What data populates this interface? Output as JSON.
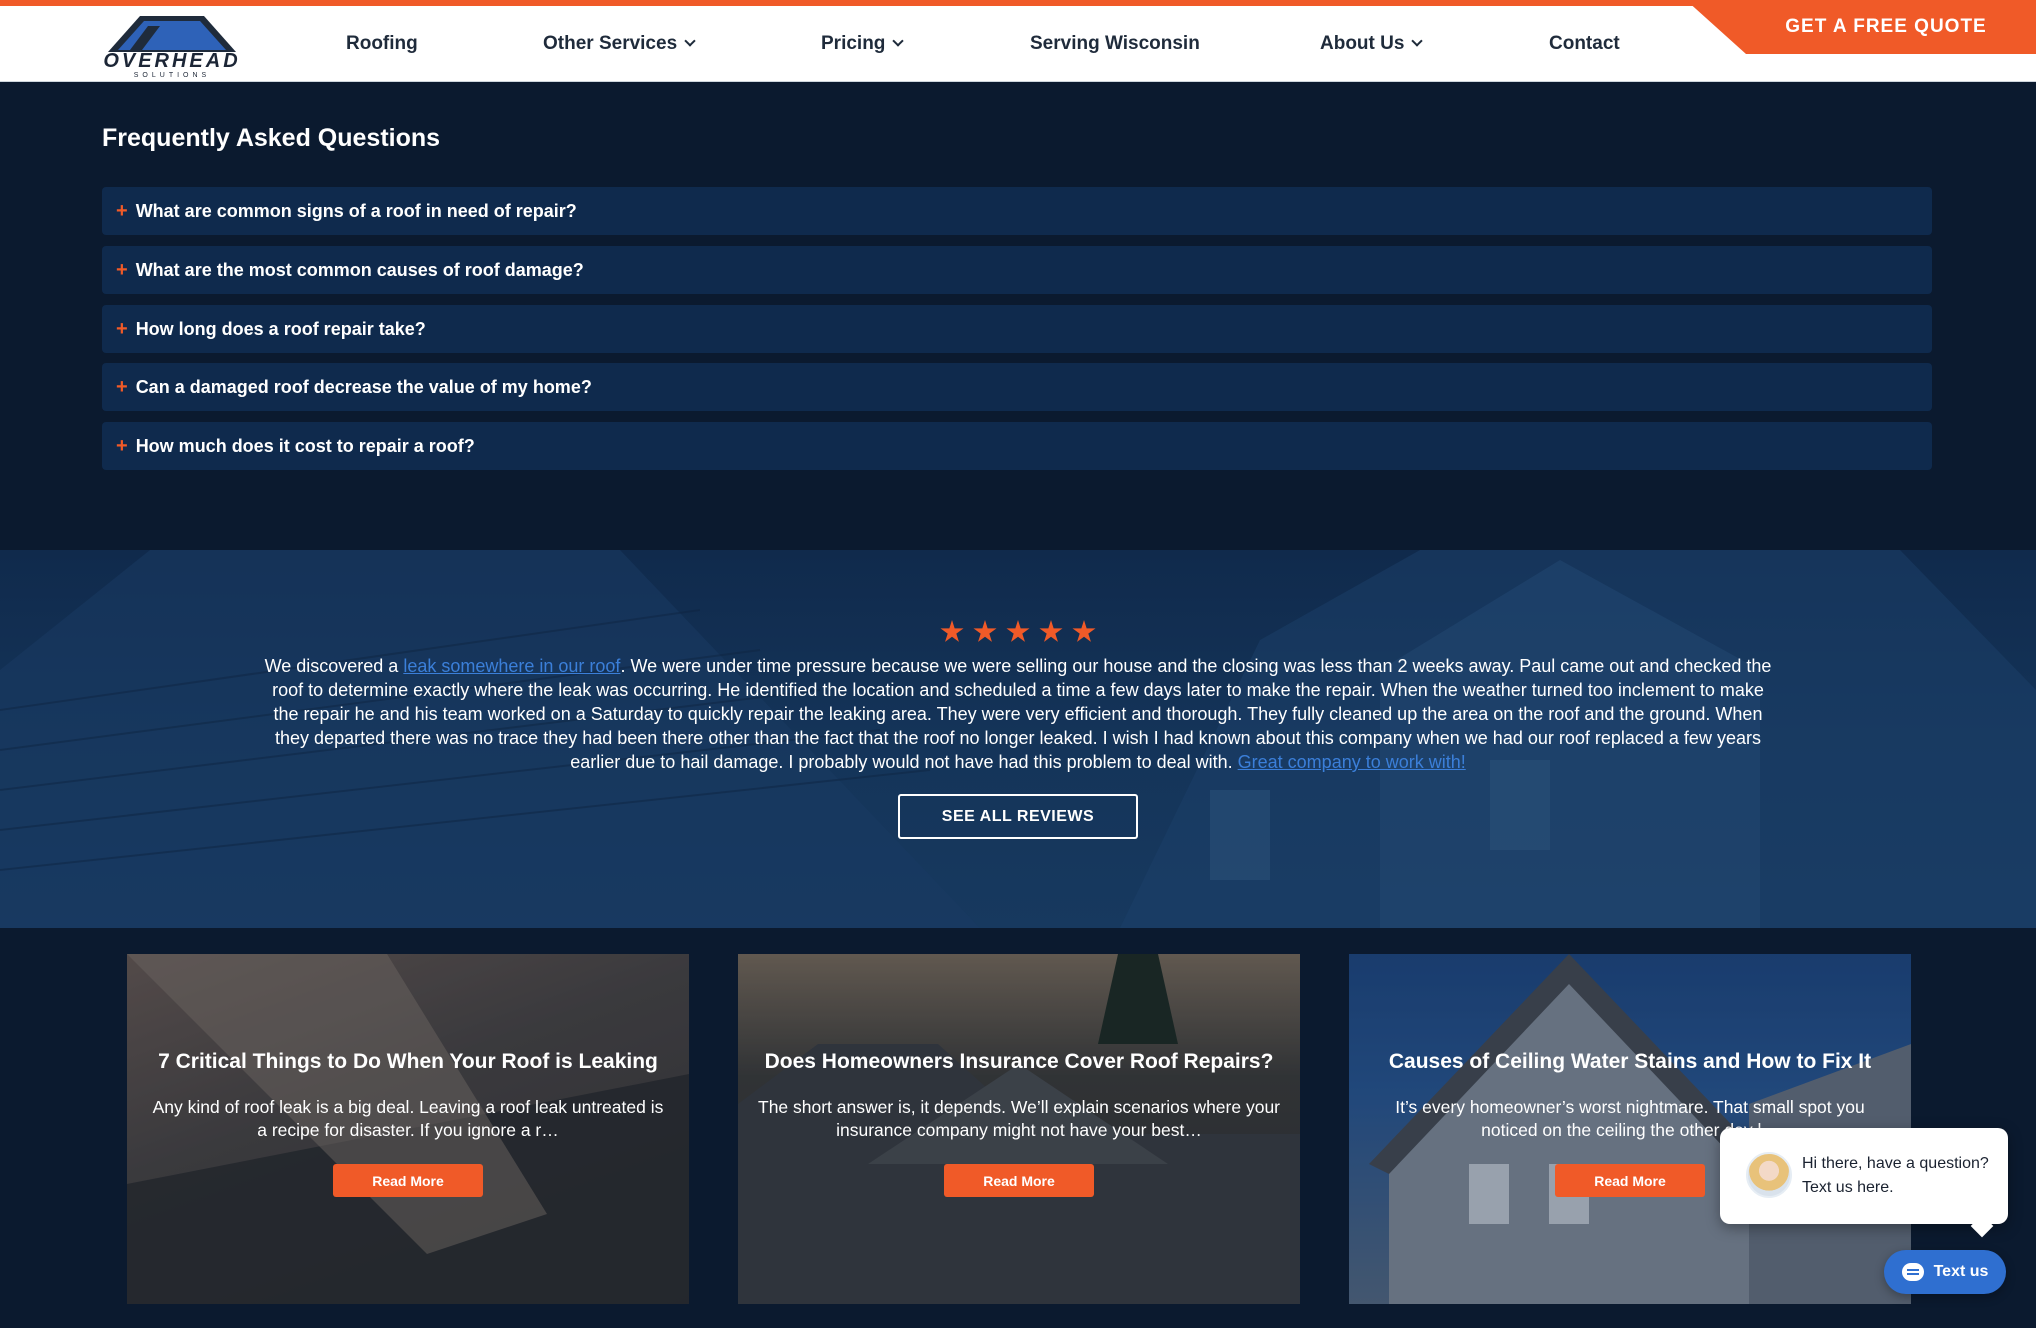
{
  "header": {
    "logo_text": "OVERHEAD",
    "logo_subtext": "SOLUTIONS",
    "nav": [
      {
        "label": "Roofing",
        "has_dropdown": false
      },
      {
        "label": "Other Services",
        "has_dropdown": true
      },
      {
        "label": "Pricing",
        "has_dropdown": true
      },
      {
        "label": "Serving Wisconsin",
        "has_dropdown": false
      },
      {
        "label": "About Us",
        "has_dropdown": true
      },
      {
        "label": "Contact",
        "has_dropdown": false
      }
    ],
    "cta_label": "GET A FREE QUOTE"
  },
  "faq": {
    "title": "Frequently Asked Questions",
    "items": [
      "What are common signs of a roof in need of repair?",
      "What are the most common causes of roof damage?",
      "How long does a roof repair take?",
      "Can a damaged roof decrease the value of my home?",
      "How much does it cost to repair a roof?"
    ]
  },
  "testimonial": {
    "rating": 5,
    "text_before_link": "We discovered a ",
    "link1": "leak somewhere in our roof",
    "text_middle": ". We were under time pressure because we were selling our house and the closing was less than 2 weeks away. Paul came out and checked the roof to determine exactly where the leak was occurring. He identified the location and scheduled a time a few days later to make the repair. When the weather turned too inclement to make the repair he and his team worked on a Saturday to quickly repair the leaking area. They were very efficient and thorough. They fully cleaned up the area on the roof and the ground. When they departed there was no trace they had been there other than the fact that the roof no longer leaked. I wish I had known about this company when we had our roof replaced a few years earlier due to hail damage. I probably would not have had this problem to deal with. ",
    "link2": "Great company to work with!",
    "button_label": "SEE ALL REVIEWS"
  },
  "cards": [
    {
      "title": "7 Critical Things to Do When Your Roof is Leaking",
      "excerpt": "Any kind of roof leak is a big deal. Leaving a roof leak untreated is a recipe for disaster. If you ignore a r…",
      "button_label": "Read More"
    },
    {
      "title": "Does Homeowners Insurance Cover Roof Repairs?",
      "excerpt": "The short answer is, it depends. We’ll explain scenarios where your insurance company might not have your best…",
      "button_label": "Read More"
    },
    {
      "title": "Causes of Ceiling Water Stains and How to Fix It",
      "excerpt": "It’s every homeowner’s worst nightmare. That small spot you noticed on the ceiling the other day l…",
      "button_label": "Read More"
    }
  ],
  "chat": {
    "message": "Hi there, have a question? Text us here.",
    "button_label": "Text us"
  },
  "colors": {
    "accent": "#f05a28",
    "background": "#0b1a2f",
    "faq_item": "#0f2a4d",
    "link": "#3b7fd9",
    "chat_button": "#2f6fd0"
  }
}
